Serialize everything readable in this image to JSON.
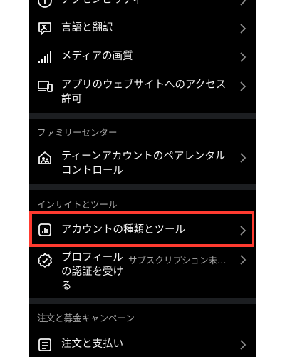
{
  "rows": {
    "top_partial": {
      "label": "アクセシビリティ"
    },
    "language": {
      "label": "言語と翻訳"
    },
    "media_quality": {
      "label": "メディアの画質"
    },
    "app_permissions": {
      "label_line1": "アプリのウェブサイトへのアクセス",
      "label_line2": "許可"
    },
    "family_center_heading": "ファミリーセンター",
    "teen_controls": {
      "label_line1": "ティーンアカウントのペアレンタル",
      "label_line2": "コントロール"
    },
    "insights_heading": "インサイトとツール",
    "account_type": {
      "label": "アカウントの種類とツール"
    },
    "verification": {
      "label_line1": "プロフィール",
      "label_line2": "の認証を受け",
      "label_line3": "る",
      "meta": "サブスクリプション未…"
    },
    "orders_heading": "注文と募金キャンペーン",
    "orders_payments": {
      "label": "注文と支払い"
    }
  },
  "colors": {
    "background": "#000000",
    "divider": "#1c1e21",
    "highlight": "#ff3b30",
    "muted_text": "#a8a8a8"
  },
  "icons": [
    "accessibility-icon",
    "translate-icon",
    "signal-bars-icon",
    "devices-icon",
    "family-home-icon",
    "insights-chart-icon",
    "verified-badge-icon",
    "receipt-icon",
    "chevron-right-icon"
  ]
}
